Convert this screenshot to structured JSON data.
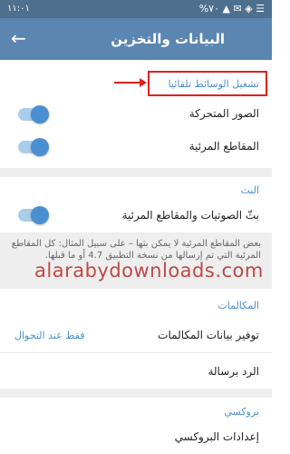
{
  "status_bar": {
    "time": "١١:٠١",
    "battery": "%٧٠",
    "icons": "▲ ✉ ◈ ☰"
  },
  "app_bar": {
    "title": "البيانات والتخزين",
    "back_icon": "arrow-back-icon"
  },
  "autoplay": {
    "header": "تشغيل الوسائط تلقائيا",
    "items": [
      {
        "label": "الصور المتحركة",
        "enabled": true
      },
      {
        "label": "المقاطع المرئية",
        "enabled": true
      }
    ]
  },
  "streaming": {
    "header": "البث",
    "items": [
      {
        "label": "بثّ الصوتيات والمقاطع المرئية",
        "enabled": true
      }
    ],
    "note": "بعض المقاطع المرئية لا يمكن بثها – على سبيل المثال: كل المقاطع المرئية التي تم إرسالها من نسخة التطبيق 4.7 أو ما قبلها."
  },
  "watermark": "alarabydownloads.com",
  "calls": {
    "header": "المكالمات",
    "data_saving_label": "توفير بيانات المكالمات",
    "data_saving_value": "فقط عند التجوال",
    "reply_label": "الرد برسالة"
  },
  "proxy": {
    "header": "بروكسي",
    "settings_label": "إعدادات البروكسي"
  },
  "colors": {
    "accent": "#4a90d0",
    "app_bar": "#5b86b1",
    "highlight": "#e02020"
  }
}
